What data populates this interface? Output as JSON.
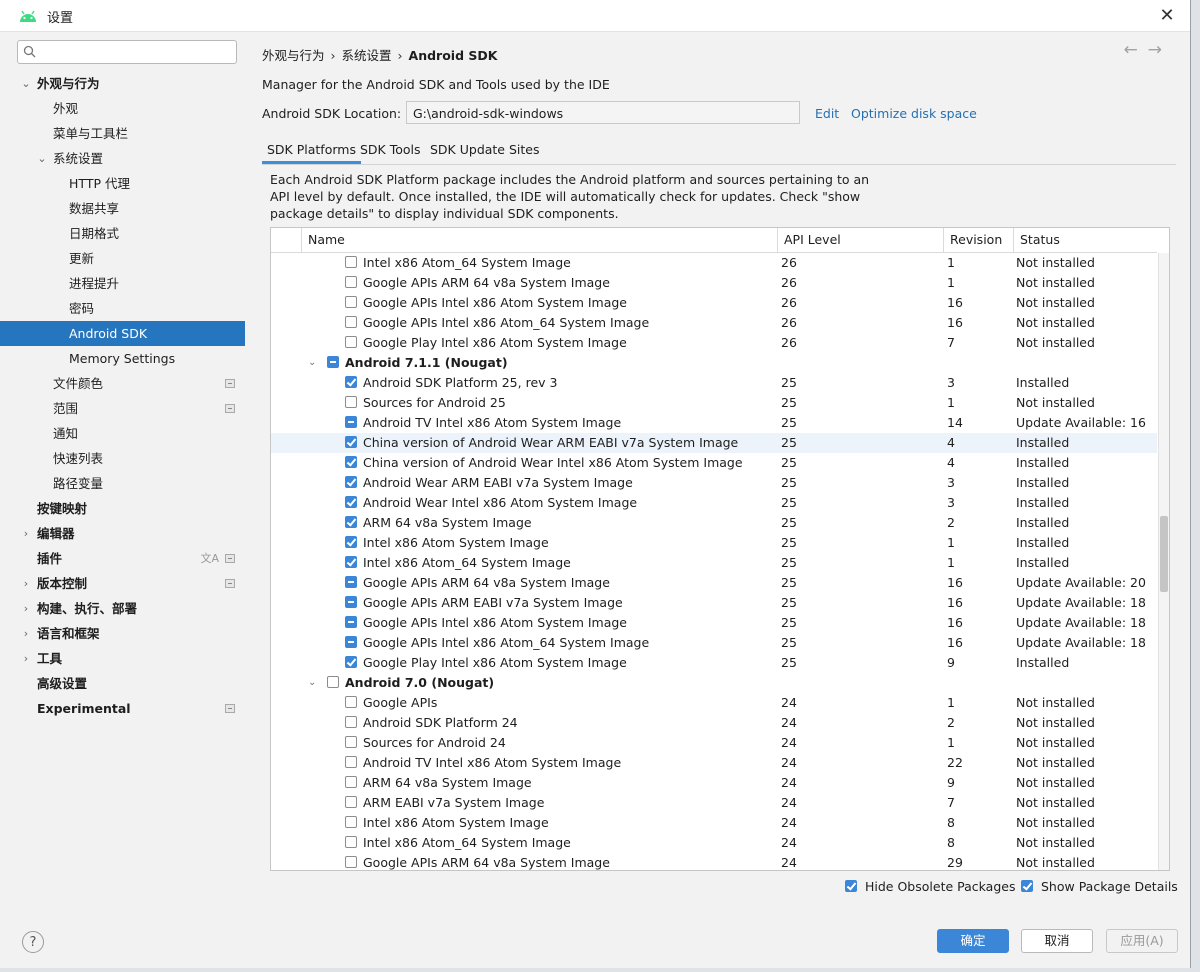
{
  "window": {
    "title": "设置",
    "close_symbol": "✕"
  },
  "search": {
    "placeholder": "",
    "value": ""
  },
  "sidebar": {
    "items": [
      {
        "label": "外观与行为",
        "level": 0,
        "bold": true,
        "expanded": true,
        "has_arrow": true
      },
      {
        "label": "外观",
        "level": 1
      },
      {
        "label": "菜单与工具栏",
        "level": 1
      },
      {
        "label": "系统设置",
        "level": 1,
        "has_arrow": true,
        "expanded": true
      },
      {
        "label": "HTTP 代理",
        "level": 2
      },
      {
        "label": "数据共享",
        "level": 2
      },
      {
        "label": "日期格式",
        "level": 2
      },
      {
        "label": "更新",
        "level": 2
      },
      {
        "label": "进程提升",
        "level": 2
      },
      {
        "label": "密码",
        "level": 2
      },
      {
        "label": "Android SDK",
        "level": 2,
        "selected": true
      },
      {
        "label": "Memory Settings",
        "level": 2
      },
      {
        "label": "文件颜色",
        "level": 1,
        "mark": true
      },
      {
        "label": "范围",
        "level": 1,
        "mark": true
      },
      {
        "label": "通知",
        "level": 1
      },
      {
        "label": "快速列表",
        "level": 1
      },
      {
        "label": "路径变量",
        "level": 1
      },
      {
        "label": "按键映射",
        "level": 0,
        "bold": true
      },
      {
        "label": "编辑器",
        "level": 0,
        "bold": true,
        "has_arrow": true
      },
      {
        "label": "插件",
        "level": 0,
        "bold": true,
        "mark": true,
        "translate": true
      },
      {
        "label": "版本控制",
        "level": 0,
        "bold": true,
        "has_arrow": true,
        "mark": true
      },
      {
        "label": "构建、执行、部署",
        "level": 0,
        "bold": true,
        "has_arrow": true
      },
      {
        "label": "语言和框架",
        "level": 0,
        "bold": true,
        "has_arrow": true
      },
      {
        "label": "工具",
        "level": 0,
        "bold": true,
        "has_arrow": true
      },
      {
        "label": "高级设置",
        "level": 0,
        "bold": true
      },
      {
        "label": "Experimental",
        "level": 0,
        "bold": true,
        "mark": true
      }
    ]
  },
  "breadcrumb": [
    "外观与行为",
    "系统设置",
    "Android SDK"
  ],
  "breadcrumb_sep": "›",
  "nav": {
    "back": "←",
    "forward": "→"
  },
  "main": {
    "description": "Manager for the Android SDK and Tools used by the IDE",
    "location_label": "Android SDK Location:",
    "location_value": "G:\\android-sdk-windows",
    "edit_link": "Edit",
    "optimize_link": "Optimize disk space",
    "tabs": [
      "SDK Platforms",
      "SDK Tools",
      "SDK Update Sites"
    ],
    "info_text": "Each Android SDK Platform package includes the Android platform and sources pertaining to an API level by default. Once installed, the IDE will automatically check for updates. Check \"show package details\" to display individual SDK components."
  },
  "table": {
    "columns": [
      "Name",
      "API Level",
      "Revision",
      "Status"
    ],
    "rows": [
      {
        "name": "Intel x86 Atom_64 System Image",
        "api": "26",
        "rev": "1",
        "status": "Not installed",
        "check": "none"
      },
      {
        "name": "Google APIs ARM 64 v8a System Image",
        "api": "26",
        "rev": "1",
        "status": "Not installed",
        "check": "none"
      },
      {
        "name": "Google APIs Intel x86 Atom System Image",
        "api": "26",
        "rev": "16",
        "status": "Not installed",
        "check": "none"
      },
      {
        "name": "Google APIs Intel x86 Atom_64 System Image",
        "api": "26",
        "rev": "16",
        "status": "Not installed",
        "check": "none"
      },
      {
        "name": "Google Play Intel x86 Atom System Image",
        "api": "26",
        "rev": "7",
        "status": "Not installed",
        "check": "none"
      },
      {
        "name": "Android 7.1.1 (Nougat)",
        "api": "",
        "rev": "",
        "status": "",
        "check": "partial",
        "group": true
      },
      {
        "name": "Android SDK Platform 25, rev 3",
        "api": "25",
        "rev": "3",
        "status": "Installed",
        "check": "checked"
      },
      {
        "name": "Sources for Android 25",
        "api": "25",
        "rev": "1",
        "status": "Not installed",
        "check": "none"
      },
      {
        "name": "Android TV Intel x86 Atom System Image",
        "api": "25",
        "rev": "14",
        "status": "Update Available: 16",
        "check": "partial"
      },
      {
        "name": "China version of Android Wear ARM EABI v7a System Image",
        "api": "25",
        "rev": "4",
        "status": "Installed",
        "check": "checked",
        "highlight": true
      },
      {
        "name": "China version of Android Wear Intel x86 Atom System Image",
        "api": "25",
        "rev": "4",
        "status": "Installed",
        "check": "checked"
      },
      {
        "name": "Android Wear ARM EABI v7a System Image",
        "api": "25",
        "rev": "3",
        "status": "Installed",
        "check": "checked"
      },
      {
        "name": "Android Wear Intel x86 Atom System Image",
        "api": "25",
        "rev": "3",
        "status": "Installed",
        "check": "checked"
      },
      {
        "name": "ARM 64 v8a System Image",
        "api": "25",
        "rev": "2",
        "status": "Installed",
        "check": "checked"
      },
      {
        "name": "Intel x86 Atom System Image",
        "api": "25",
        "rev": "1",
        "status": "Installed",
        "check": "checked"
      },
      {
        "name": "Intel x86 Atom_64 System Image",
        "api": "25",
        "rev": "1",
        "status": "Installed",
        "check": "checked"
      },
      {
        "name": "Google APIs ARM 64 v8a System Image",
        "api": "25",
        "rev": "16",
        "status": "Update Available: 20",
        "check": "partial"
      },
      {
        "name": "Google APIs ARM EABI v7a System Image",
        "api": "25",
        "rev": "16",
        "status": "Update Available: 18",
        "check": "partial"
      },
      {
        "name": "Google APIs Intel x86 Atom System Image",
        "api": "25",
        "rev": "16",
        "status": "Update Available: 18",
        "check": "partial"
      },
      {
        "name": "Google APIs Intel x86 Atom_64 System Image",
        "api": "25",
        "rev": "16",
        "status": "Update Available: 18",
        "check": "partial"
      },
      {
        "name": "Google Play Intel x86 Atom System Image",
        "api": "25",
        "rev": "9",
        "status": "Installed",
        "check": "checked"
      },
      {
        "name": "Android 7.0 (Nougat)",
        "api": "",
        "rev": "",
        "status": "",
        "check": "none",
        "group": true
      },
      {
        "name": "Google APIs",
        "api": "24",
        "rev": "1",
        "status": "Not installed",
        "check": "none"
      },
      {
        "name": "Android SDK Platform 24",
        "api": "24",
        "rev": "2",
        "status": "Not installed",
        "check": "none"
      },
      {
        "name": "Sources for Android 24",
        "api": "24",
        "rev": "1",
        "status": "Not installed",
        "check": "none"
      },
      {
        "name": "Android TV Intel x86 Atom System Image",
        "api": "24",
        "rev": "22",
        "status": "Not installed",
        "check": "none"
      },
      {
        "name": "ARM 64 v8a System Image",
        "api": "24",
        "rev": "9",
        "status": "Not installed",
        "check": "none"
      },
      {
        "name": "ARM EABI v7a System Image",
        "api": "24",
        "rev": "7",
        "status": "Not installed",
        "check": "none"
      },
      {
        "name": "Intel x86 Atom System Image",
        "api": "24",
        "rev": "8",
        "status": "Not installed",
        "check": "none"
      },
      {
        "name": "Intel x86 Atom_64 System Image",
        "api": "24",
        "rev": "8",
        "status": "Not installed",
        "check": "none"
      },
      {
        "name": "Google APIs ARM 64 v8a System Image",
        "api": "24",
        "rev": "29",
        "status": "Not installed",
        "check": "none"
      }
    ]
  },
  "options": {
    "hide_obsolete": {
      "label": "Hide Obsolete Packages",
      "checked": true
    },
    "show_details": {
      "label": "Show Package Details",
      "checked": true
    }
  },
  "buttons": {
    "help": "?",
    "ok": "确定",
    "cancel": "取消",
    "apply": "应用(A)"
  },
  "colors": {
    "accent": "#3b86d6",
    "selection": "#2675bf",
    "link": "#2470b3"
  }
}
